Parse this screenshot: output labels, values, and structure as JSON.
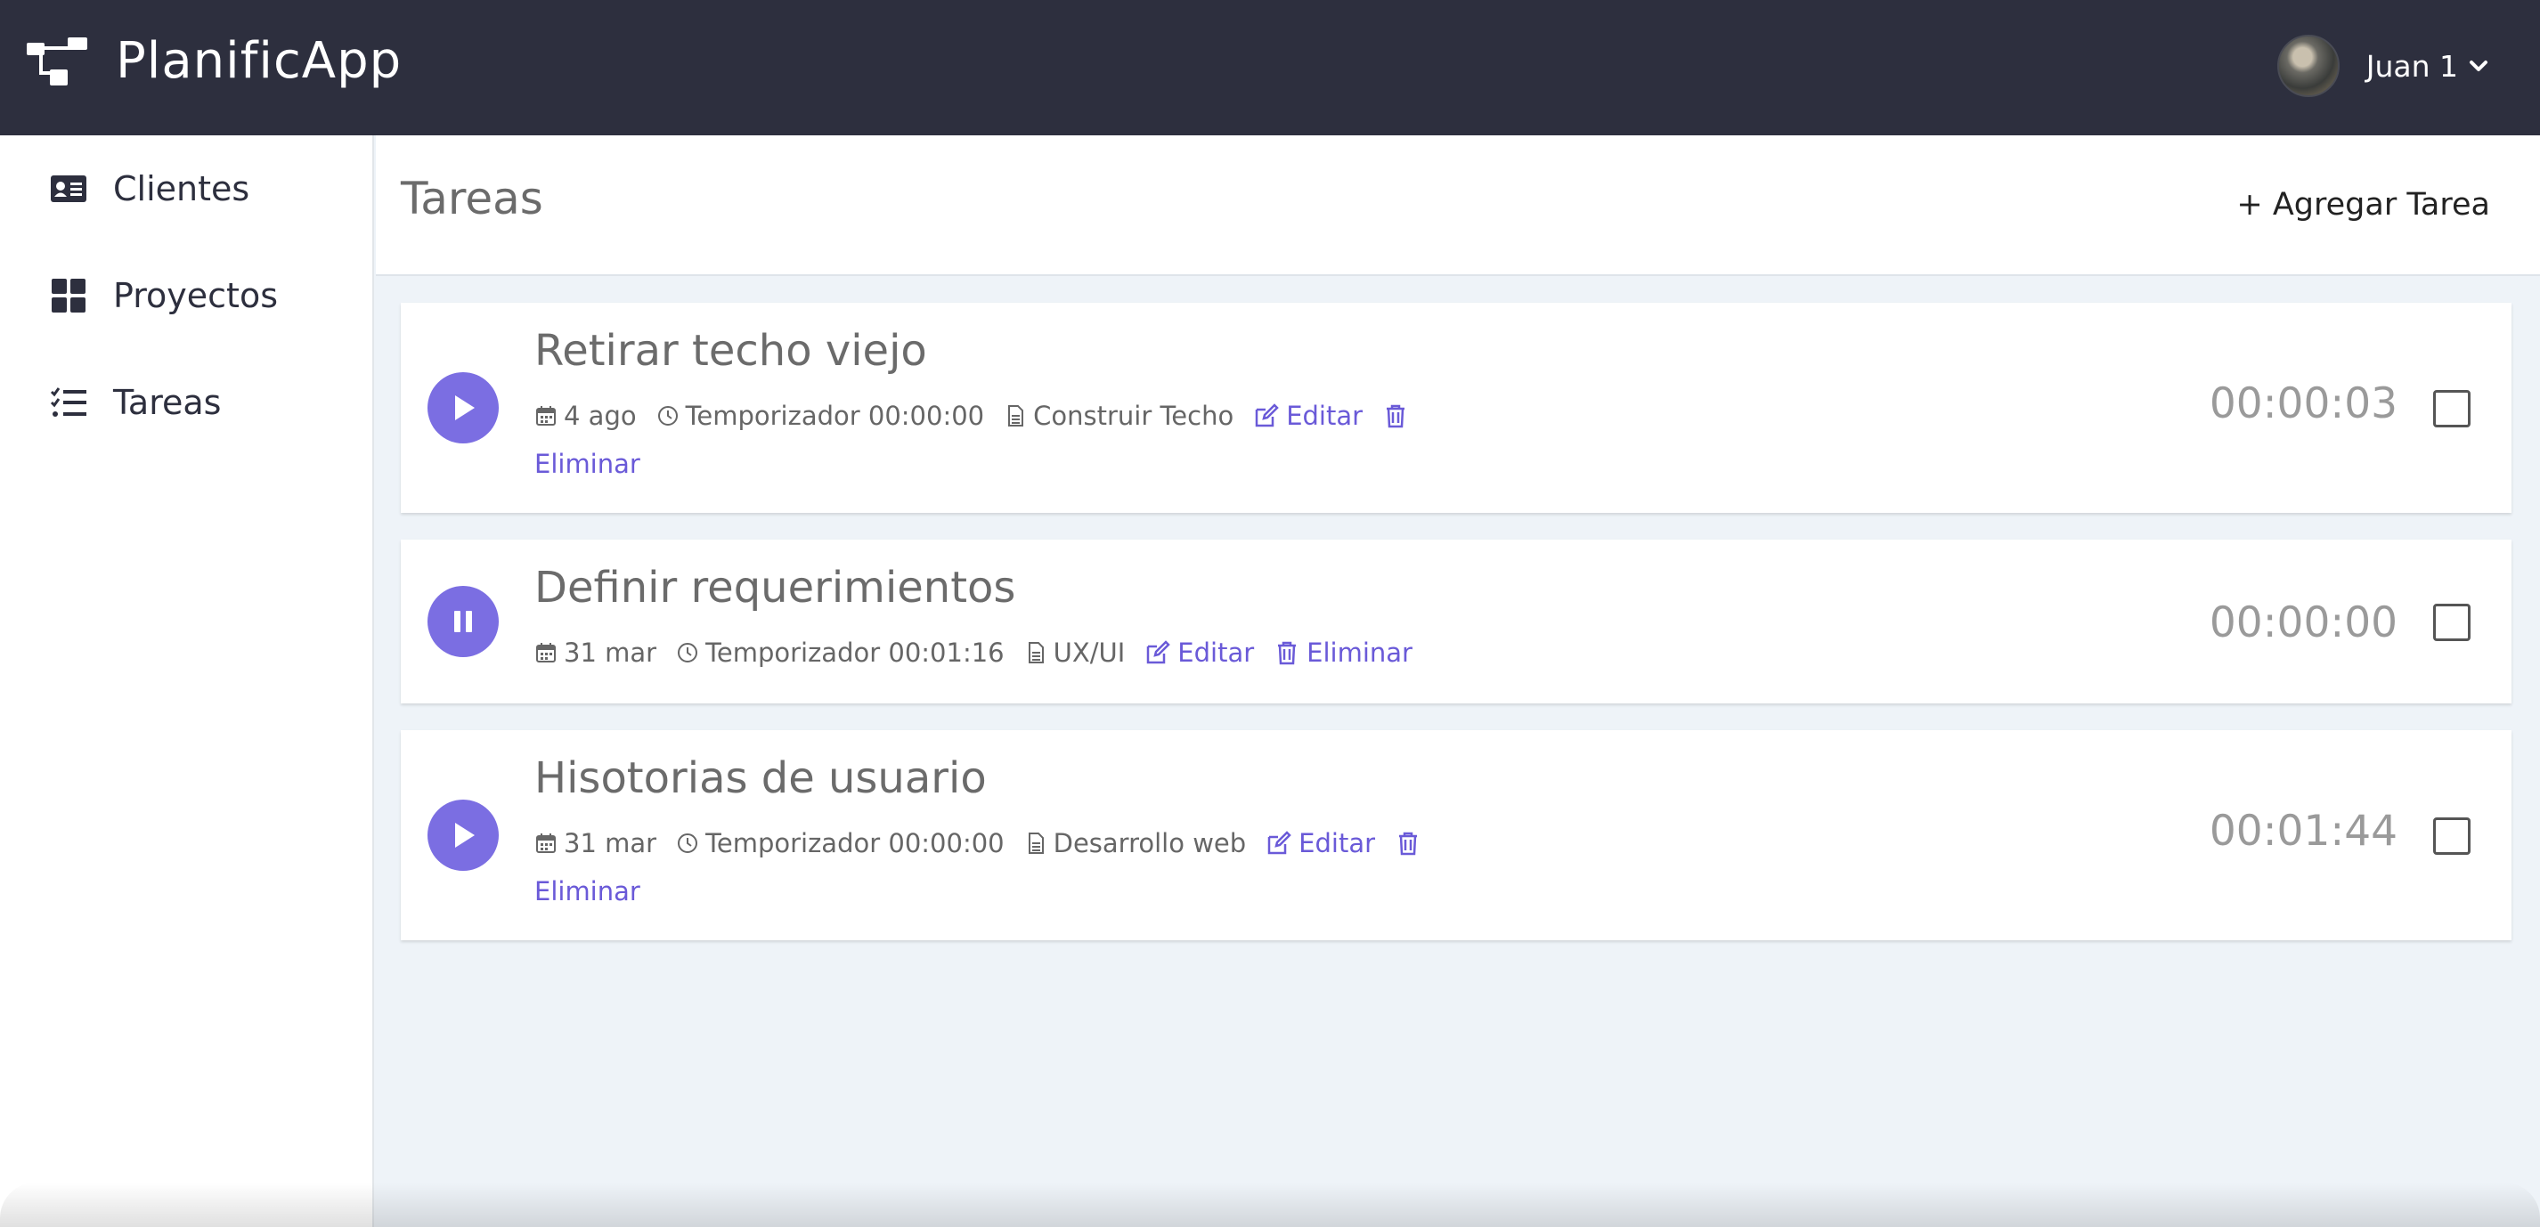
{
  "app": {
    "name": "PlanificApp"
  },
  "user": {
    "name": "Juan 1"
  },
  "sidebar": {
    "items": [
      {
        "label": "Clientes",
        "icon": "id-card-icon"
      },
      {
        "label": "Proyectos",
        "icon": "grid-icon"
      },
      {
        "label": "Tareas",
        "icon": "tasks-icon"
      }
    ]
  },
  "page": {
    "title": "Tareas",
    "add_label": "+ Agregar Tarea"
  },
  "tasks": [
    {
      "title": "Retirar techo viejo",
      "date": "4 ago",
      "timer_label": "Temporizador 00:00:00",
      "project": "Construir Techo",
      "edit_label": "Editar",
      "delete_label": "Eliminar",
      "elapsed": "00:00:03",
      "state": "paused",
      "button_icon": "play-icon"
    },
    {
      "title": "Definir requerimientos",
      "date": "31 mar",
      "timer_label": "Temporizador 00:01:16",
      "project": "UX/UI",
      "edit_label": "Editar",
      "delete_label": "Eliminar",
      "elapsed": "00:00:00",
      "state": "running",
      "button_icon": "pause-icon"
    },
    {
      "title": "Hisotorias de usuario",
      "date": "31 mar",
      "timer_label": "Temporizador 00:00:00",
      "project": "Desarrollo web",
      "edit_label": "Editar",
      "delete_label": "Eliminar",
      "elapsed": "00:01:44",
      "state": "paused",
      "button_icon": "play-icon"
    }
  ],
  "colors": {
    "header_bg": "#2d2f3e",
    "accent": "#7b6ee2",
    "link": "#6a5ad8",
    "main_bg": "#eef3f8"
  }
}
